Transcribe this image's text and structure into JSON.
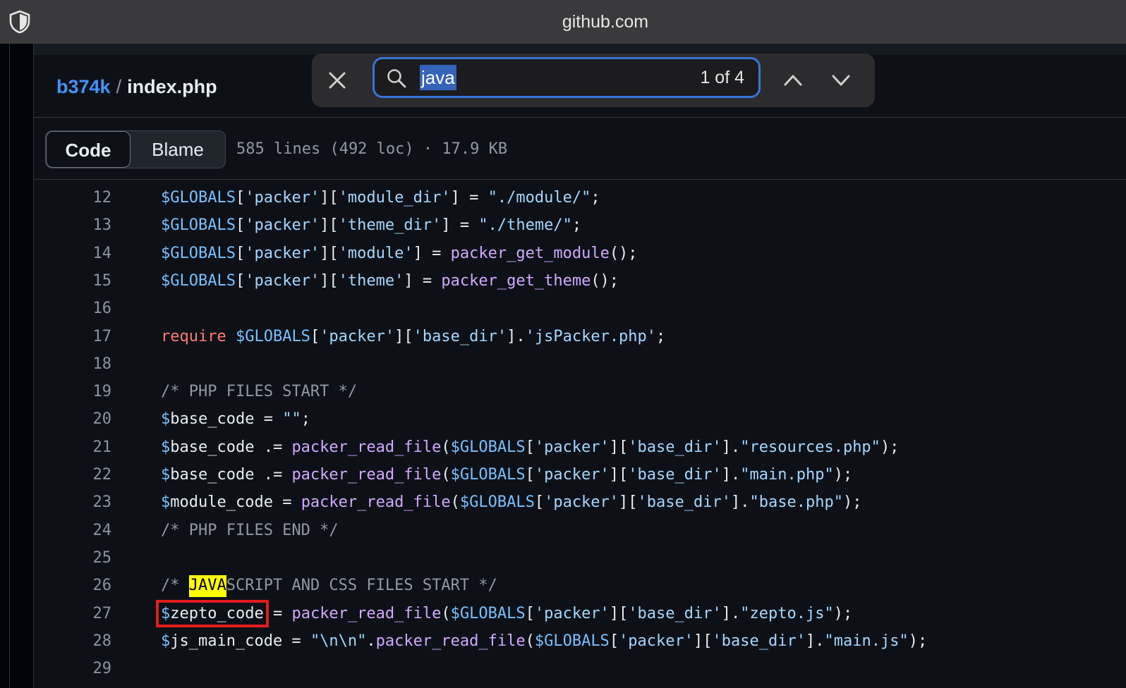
{
  "browser": {
    "url": "github.com"
  },
  "breadcrumb": {
    "repo": "b374k",
    "separator": "/",
    "file": "index.php"
  },
  "find": {
    "query": "java",
    "count": "1 of 4"
  },
  "tabs": {
    "code": "Code",
    "blame": "Blame"
  },
  "file_meta": "585 lines (492 loc) · 17.9 KB",
  "icons": {
    "shield": "shield-icon",
    "close": "close-icon",
    "search": "search-icon",
    "prev": "chevron-up-icon",
    "next": "chevron-down-icon"
  },
  "colors": {
    "variable": "#79c0ff",
    "string": "#a5d6ff",
    "function": "#d2a8ff",
    "keyword": "#ff7b72",
    "comment": "#9198a1",
    "find_highlight": "#ffff00",
    "annotation_box": "#e11d1d"
  },
  "code": {
    "lines": [
      {
        "n": "12",
        "tokens": [
          {
            "t": "$GLOBALS",
            "c": "var"
          },
          {
            "t": "["
          },
          {
            "t": "'packer'",
            "c": "str"
          },
          {
            "t": "]["
          },
          {
            "t": "'module_dir'",
            "c": "str"
          },
          {
            "t": "] = "
          },
          {
            "t": "\"./module/\"",
            "c": "str"
          },
          {
            "t": ";"
          }
        ]
      },
      {
        "n": "13",
        "tokens": [
          {
            "t": "$GLOBALS",
            "c": "var"
          },
          {
            "t": "["
          },
          {
            "t": "'packer'",
            "c": "str"
          },
          {
            "t": "]["
          },
          {
            "t": "'theme_dir'",
            "c": "str"
          },
          {
            "t": "] = "
          },
          {
            "t": "\"./theme/\"",
            "c": "str"
          },
          {
            "t": ";"
          }
        ]
      },
      {
        "n": "14",
        "tokens": [
          {
            "t": "$GLOBALS",
            "c": "var"
          },
          {
            "t": "["
          },
          {
            "t": "'packer'",
            "c": "str"
          },
          {
            "t": "]["
          },
          {
            "t": "'module'",
            "c": "str"
          },
          {
            "t": "] = "
          },
          {
            "t": "packer_get_module",
            "c": "fn"
          },
          {
            "t": "();"
          }
        ]
      },
      {
        "n": "15",
        "tokens": [
          {
            "t": "$GLOBALS",
            "c": "var"
          },
          {
            "t": "["
          },
          {
            "t": "'packer'",
            "c": "str"
          },
          {
            "t": "]["
          },
          {
            "t": "'theme'",
            "c": "str"
          },
          {
            "t": "] = "
          },
          {
            "t": "packer_get_theme",
            "c": "fn"
          },
          {
            "t": "();"
          }
        ]
      },
      {
        "n": "16",
        "tokens": []
      },
      {
        "n": "17",
        "tokens": [
          {
            "t": "require",
            "c": "kw"
          },
          {
            "t": " "
          },
          {
            "t": "$GLOBALS",
            "c": "var"
          },
          {
            "t": "["
          },
          {
            "t": "'packer'",
            "c": "str"
          },
          {
            "t": "]["
          },
          {
            "t": "'base_dir'",
            "c": "str"
          },
          {
            "t": "]."
          },
          {
            "t": "'jsPacker.php'",
            "c": "str"
          },
          {
            "t": ";"
          }
        ]
      },
      {
        "n": "18",
        "tokens": []
      },
      {
        "n": "19",
        "tokens": [
          {
            "t": "/* PHP FILES START */",
            "c": "cm"
          }
        ]
      },
      {
        "n": "20",
        "tokens": [
          {
            "t": "$",
            "c": "var"
          },
          {
            "t": "base_code = "
          },
          {
            "t": "\"\"",
            "c": "str"
          },
          {
            "t": ";"
          }
        ]
      },
      {
        "n": "21",
        "tokens": [
          {
            "t": "$",
            "c": "var"
          },
          {
            "t": "base_code .= "
          },
          {
            "t": "packer_read_file",
            "c": "fn"
          },
          {
            "t": "("
          },
          {
            "t": "$GLOBALS",
            "c": "var"
          },
          {
            "t": "["
          },
          {
            "t": "'packer'",
            "c": "str"
          },
          {
            "t": "]["
          },
          {
            "t": "'base_dir'",
            "c": "str"
          },
          {
            "t": "]."
          },
          {
            "t": "\"resources.php\"",
            "c": "str"
          },
          {
            "t": ");"
          }
        ]
      },
      {
        "n": "22",
        "tokens": [
          {
            "t": "$",
            "c": "var"
          },
          {
            "t": "base_code .= "
          },
          {
            "t": "packer_read_file",
            "c": "fn"
          },
          {
            "t": "("
          },
          {
            "t": "$GLOBALS",
            "c": "var"
          },
          {
            "t": "["
          },
          {
            "t": "'packer'",
            "c": "str"
          },
          {
            "t": "]["
          },
          {
            "t": "'base_dir'",
            "c": "str"
          },
          {
            "t": "]."
          },
          {
            "t": "\"main.php\"",
            "c": "str"
          },
          {
            "t": ");"
          }
        ]
      },
      {
        "n": "23",
        "tokens": [
          {
            "t": "$",
            "c": "var"
          },
          {
            "t": "module_code = "
          },
          {
            "t": "packer_read_file",
            "c": "fn"
          },
          {
            "t": "("
          },
          {
            "t": "$GLOBALS",
            "c": "var"
          },
          {
            "t": "["
          },
          {
            "t": "'packer'",
            "c": "str"
          },
          {
            "t": "]["
          },
          {
            "t": "'base_dir'",
            "c": "str"
          },
          {
            "t": "]."
          },
          {
            "t": "\"base.php\"",
            "c": "str"
          },
          {
            "t": ");"
          }
        ]
      },
      {
        "n": "24",
        "tokens": [
          {
            "t": "/* PHP FILES END */",
            "c": "cm"
          }
        ]
      },
      {
        "n": "25",
        "tokens": []
      },
      {
        "n": "26",
        "tokens": [
          {
            "t": "/* ",
            "c": "cm"
          },
          {
            "t": "JAVA",
            "c": "hl"
          },
          {
            "t": "SCRIPT AND CSS FILES START */",
            "c": "cm"
          }
        ]
      },
      {
        "n": "27",
        "tokens": [
          {
            "t": "$zepto_code",
            "c": "boxed",
            "parts": [
              {
                "t": "$",
                "c": "var"
              },
              {
                "t": "zepto_code"
              }
            ]
          },
          {
            "t": " = "
          },
          {
            "t": "packer_read_file",
            "c": "fn"
          },
          {
            "t": "("
          },
          {
            "t": "$GLOBALS",
            "c": "var"
          },
          {
            "t": "["
          },
          {
            "t": "'packer'",
            "c": "str"
          },
          {
            "t": "]["
          },
          {
            "t": "'base_dir'",
            "c": "str"
          },
          {
            "t": "]."
          },
          {
            "t": "\"zepto.js\"",
            "c": "str"
          },
          {
            "t": ");"
          }
        ]
      },
      {
        "n": "28",
        "tokens": [
          {
            "t": "$",
            "c": "var"
          },
          {
            "t": "js_main_code = "
          },
          {
            "t": "\"\\n\\n\"",
            "c": "str"
          },
          {
            "t": "."
          },
          {
            "t": "packer_read_file",
            "c": "fn"
          },
          {
            "t": "("
          },
          {
            "t": "$GLOBALS",
            "c": "var"
          },
          {
            "t": "["
          },
          {
            "t": "'packer'",
            "c": "str"
          },
          {
            "t": "]["
          },
          {
            "t": "'base_dir'",
            "c": "str"
          },
          {
            "t": "]."
          },
          {
            "t": "\"main.js\"",
            "c": "str"
          },
          {
            "t": ");"
          }
        ]
      },
      {
        "n": "29",
        "tokens": []
      }
    ]
  }
}
